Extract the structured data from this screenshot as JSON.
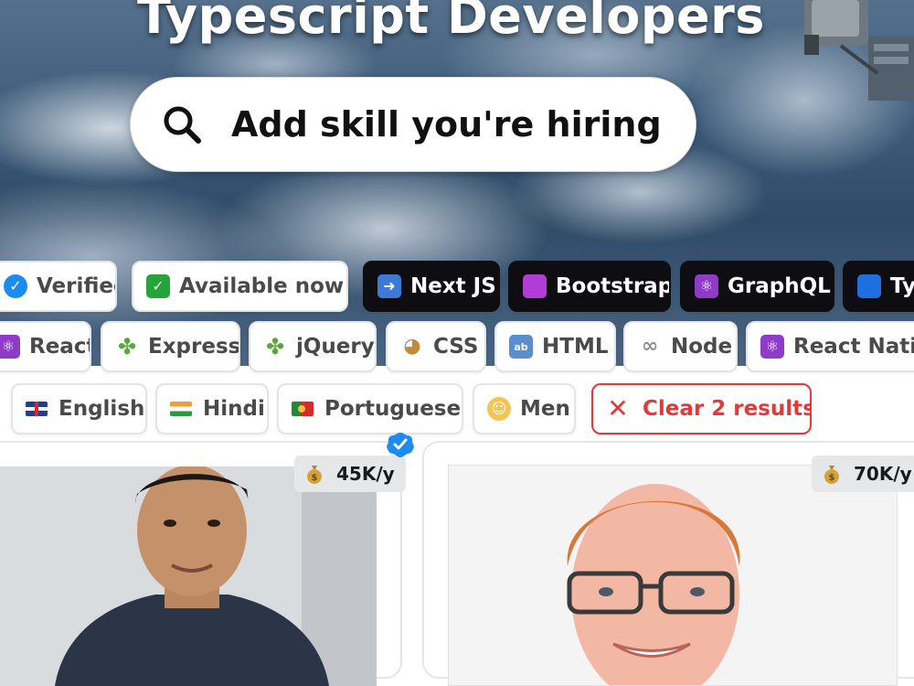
{
  "hero": {
    "title": "Typescript Developers"
  },
  "search": {
    "placeholder": "Add skill you're hiring",
    "value": ""
  },
  "filters": {
    "row1": [
      {
        "label": "Verified",
        "icon": "verified-icon",
        "style": "light"
      },
      {
        "label": "Available now",
        "icon": "checkmark-icon",
        "style": "light"
      },
      {
        "label": "Next JS",
        "icon": "arrow-right-icon",
        "style": "dark"
      },
      {
        "label": "Bootstrap",
        "icon": "purple-square-icon",
        "style": "dark"
      },
      {
        "label": "GraphQL",
        "icon": "atom-icon",
        "style": "dark"
      },
      {
        "label": "Typ",
        "icon": "blue-square-icon",
        "style": "dark"
      }
    ],
    "row2": [
      {
        "label": "React",
        "icon": "atom-icon"
      },
      {
        "label": "Express",
        "icon": "puzzle-icon"
      },
      {
        "label": "jQuery",
        "icon": "puzzle-icon"
      },
      {
        "label": "CSS",
        "icon": "palette-icon"
      },
      {
        "label": "HTML",
        "icon": "abcd-icon"
      },
      {
        "label": "Node",
        "icon": "link-icon"
      },
      {
        "label": "React Nativ",
        "icon": "atom-icon"
      }
    ],
    "row3": [
      {
        "label": "English",
        "icon": "uk-flag-icon"
      },
      {
        "label": "Hindi",
        "icon": "india-flag-icon"
      },
      {
        "label": "Portuguese",
        "icon": "portugal-flag-icon"
      },
      {
        "label": "Men",
        "icon": "man-icon"
      },
      {
        "label": "Clear 2 results",
        "icon": "close-icon",
        "style": "danger"
      }
    ]
  },
  "cards": [
    {
      "salary": "45K/y",
      "photo": "developer-photo"
    },
    {
      "salary": "70K/y",
      "photo": "developer-photo"
    }
  ],
  "colors": {
    "accent": "#1d8cf0",
    "danger": "#e03a3a",
    "dark_chip": "#0d0d12",
    "chip_border": "#e1e4e8"
  }
}
